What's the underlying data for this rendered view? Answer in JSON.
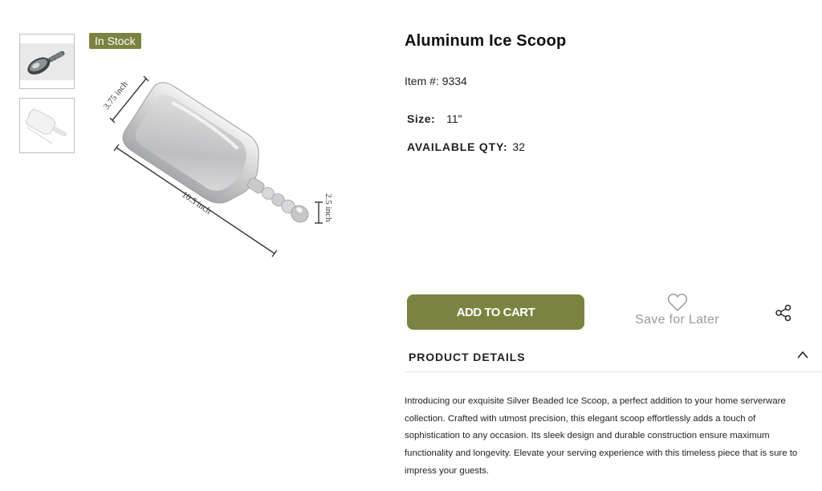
{
  "gallery": {
    "badge": "In Stock",
    "dimension_labels": {
      "width": "3.75 inch",
      "length": "10.5 inch",
      "height": "2.5 inch"
    }
  },
  "product": {
    "title": "Aluminum Ice Scoop",
    "item_label": "Item #:",
    "item_number": "9334",
    "size_label": "Size:",
    "size_value": "11\"",
    "qty_label": "AVAILABLE QTY:",
    "qty_value": "32"
  },
  "actions": {
    "add_to_cart": "ADD TO CART",
    "save_for_later": "Save for Later"
  },
  "details": {
    "header": "PRODUCT DETAILS",
    "description": "Introducing our exquisite Silver Beaded Ice Scoop, a perfect addition to your home serverware collection. Crafted with utmost precision, this elegant scoop effortlessly adds a touch of sophistication to any occasion. Its sleek design and durable construction ensure maximum functionality and longevity. Elevate your serving experience with this timeless piece that is sure to impress your guests."
  },
  "colors": {
    "accent": "#7b8340",
    "muted_text": "#9a9a9a",
    "divider": "#e2e2e2"
  },
  "icons": {
    "save": "heart-icon",
    "share": "share-icon",
    "collapse": "chevron-up-icon"
  }
}
